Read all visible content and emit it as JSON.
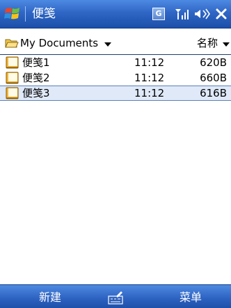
{
  "title_bar": {
    "app_title": "便笺",
    "status_g_label": "G"
  },
  "header": {
    "folder_label": "My Documents",
    "sort_label": "名称"
  },
  "files": [
    {
      "name": "便笺1",
      "time": "11:12",
      "size": "620B"
    },
    {
      "name": "便笺2",
      "time": "11:12",
      "size": "660B"
    },
    {
      "name": "便笺3",
      "time": "11:12",
      "size": "616B"
    }
  ],
  "menu_bar": {
    "left_softkey": "新建",
    "right_softkey": "菜单"
  },
  "colors": {
    "bar_blue": "#2f66c5",
    "selection": "#dfe9f8"
  },
  "icons": {
    "start": "windows-flag-icon",
    "signal": "signal-strength-icon",
    "volume": "speaker-volume-icon",
    "close": "close-icon",
    "folder": "open-folder-icon",
    "note": "note-file-icon",
    "sip": "input-panel-icon"
  }
}
